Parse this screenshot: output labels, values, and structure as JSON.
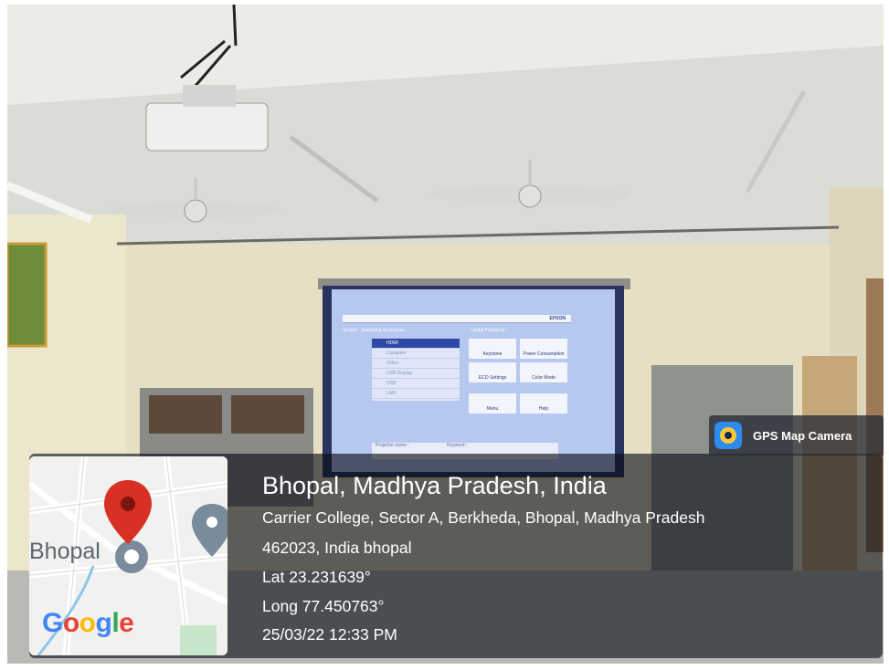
{
  "photo": {
    "description": "Classroom with ceiling-mounted projector, two ceiling fans and a projection screen",
    "projector_screen": {
      "brand": "EPSON",
      "source_header": "Source : Searching all sources ...",
      "features_header": "Useful Functions :",
      "sources": [
        "HDMI",
        "Computer",
        "Video",
        "USB Display",
        "USB",
        "LAN"
      ],
      "functions": [
        "Keystone",
        "Power Consumption",
        "ECO Settings",
        "Color Mode",
        "Menu",
        "Help"
      ],
      "info_label": "Projector name :",
      "keyword_label": "Keyword :"
    }
  },
  "gps": {
    "app_name": "GPS Map Camera",
    "title": "Bhopal, Madhya Pradesh, India",
    "address_line1": "Carrier College, Sector A, Berkheda, Bhopal, Madhya Pradesh",
    "address_line2": "462023, India bhopal",
    "latitude": "Lat 23.231639°",
    "longitude": "Long 77.450763°",
    "datetime": "25/03/22 12:33 PM",
    "map": {
      "city_label": "Bhopal",
      "provider": "Google",
      "pin_color": "#d93025",
      "secondary_pin_color": "#7a8b9c"
    }
  }
}
